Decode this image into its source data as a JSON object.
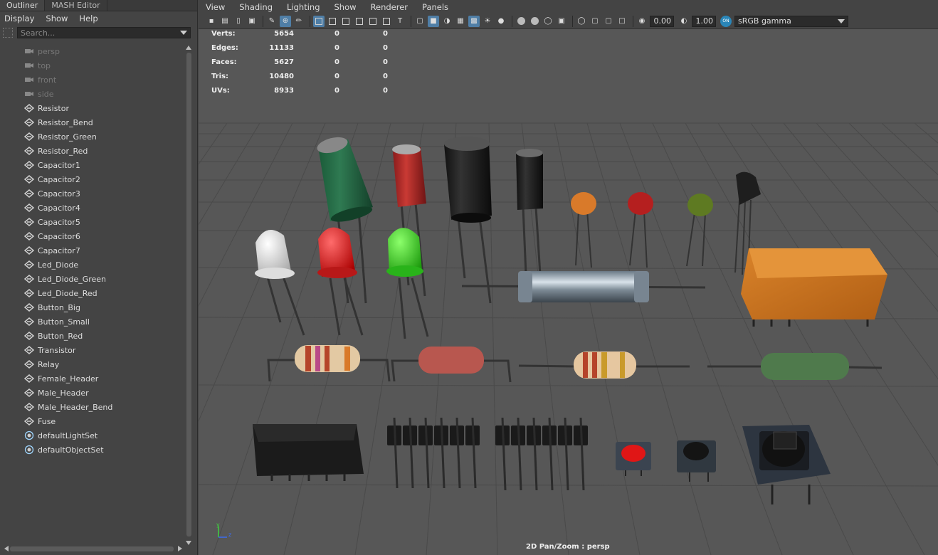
{
  "outliner": {
    "tabs": [
      "Outliner",
      "MASH Editor"
    ],
    "menu": [
      "Display",
      "Show",
      "Help"
    ],
    "search_placeholder": "Search...",
    "items": [
      {
        "label": "persp",
        "type": "camera"
      },
      {
        "label": "top",
        "type": "camera"
      },
      {
        "label": "front",
        "type": "camera"
      },
      {
        "label": "side",
        "type": "camera"
      },
      {
        "label": "Resistor",
        "type": "transform"
      },
      {
        "label": "Resistor_Bend",
        "type": "transform"
      },
      {
        "label": "Resistor_Green",
        "type": "transform"
      },
      {
        "label": "Resistor_Red",
        "type": "transform"
      },
      {
        "label": "Capacitor1",
        "type": "transform"
      },
      {
        "label": "Capacitor2",
        "type": "transform"
      },
      {
        "label": "Capacitor3",
        "type": "transform"
      },
      {
        "label": "Capacitor4",
        "type": "transform"
      },
      {
        "label": "Capacitor5",
        "type": "transform"
      },
      {
        "label": "Capacitor6",
        "type": "transform"
      },
      {
        "label": "Capacitor7",
        "type": "transform"
      },
      {
        "label": "Led_Diode",
        "type": "transform"
      },
      {
        "label": "Led_Diode_Green",
        "type": "transform"
      },
      {
        "label": "Led_Diode_Red",
        "type": "transform"
      },
      {
        "label": "Button_Big",
        "type": "transform"
      },
      {
        "label": "Button_Small",
        "type": "transform"
      },
      {
        "label": "Button_Red",
        "type": "transform"
      },
      {
        "label": "Transistor",
        "type": "transform"
      },
      {
        "label": "Relay",
        "type": "transform"
      },
      {
        "label": "Female_Header",
        "type": "transform"
      },
      {
        "label": "Male_Header",
        "type": "transform"
      },
      {
        "label": "Male_Header_Bend",
        "type": "transform"
      },
      {
        "label": "Fuse",
        "type": "transform"
      },
      {
        "label": "defaultLightSet",
        "type": "set"
      },
      {
        "label": "defaultObjectSet",
        "type": "set"
      }
    ]
  },
  "viewport": {
    "menu": [
      "View",
      "Shading",
      "Lighting",
      "Show",
      "Renderer",
      "Panels"
    ],
    "exposure": "0.00",
    "gamma_value": "1.00",
    "color_space": "sRGB gamma",
    "hud": [
      {
        "label": "Verts:",
        "v": "5654",
        "a": "0",
        "b": "0"
      },
      {
        "label": "Edges:",
        "v": "11133",
        "a": "0",
        "b": "0"
      },
      {
        "label": "Faces:",
        "v": "5627",
        "a": "0",
        "b": "0"
      },
      {
        "label": "Tris:",
        "v": "10480",
        "a": "0",
        "b": "0"
      },
      {
        "label": "UVs:",
        "v": "8933",
        "a": "0",
        "b": "0"
      }
    ],
    "camera_label": "2D Pan/Zoom : persp",
    "axis_y": "y",
    "axis_z": "z"
  }
}
